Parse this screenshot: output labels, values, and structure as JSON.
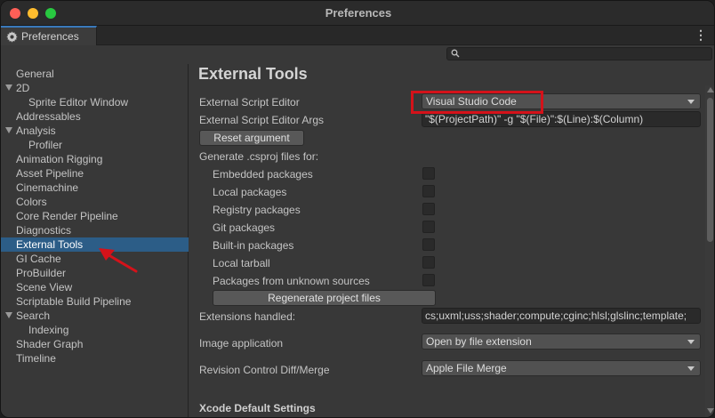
{
  "window": {
    "title": "Preferences"
  },
  "tab": {
    "label": "Preferences",
    "icon": "gear-icon"
  },
  "search": {
    "placeholder": "",
    "icon": "search-icon"
  },
  "sidebar": {
    "items": [
      {
        "label": "General",
        "indent": 0,
        "expander": false,
        "selected": false
      },
      {
        "label": "2D",
        "indent": 0,
        "expander": true,
        "selected": false
      },
      {
        "label": "Sprite Editor Window",
        "indent": 1,
        "expander": false,
        "selected": false
      },
      {
        "label": "Addressables",
        "indent": 0,
        "expander": false,
        "selected": false
      },
      {
        "label": "Analysis",
        "indent": 0,
        "expander": true,
        "selected": false
      },
      {
        "label": "Profiler",
        "indent": 1,
        "expander": false,
        "selected": false
      },
      {
        "label": "Animation Rigging",
        "indent": 0,
        "expander": false,
        "selected": false
      },
      {
        "label": "Asset Pipeline",
        "indent": 0,
        "expander": false,
        "selected": false
      },
      {
        "label": "Cinemachine",
        "indent": 0,
        "expander": false,
        "selected": false
      },
      {
        "label": "Colors",
        "indent": 0,
        "expander": false,
        "selected": false
      },
      {
        "label": "Core Render Pipeline",
        "indent": 0,
        "expander": false,
        "selected": false
      },
      {
        "label": "Diagnostics",
        "indent": 0,
        "expander": false,
        "selected": false
      },
      {
        "label": "External Tools",
        "indent": 0,
        "expander": false,
        "selected": true
      },
      {
        "label": "GI Cache",
        "indent": 0,
        "expander": false,
        "selected": false
      },
      {
        "label": "ProBuilder",
        "indent": 0,
        "expander": false,
        "selected": false
      },
      {
        "label": "Scene View",
        "indent": 0,
        "expander": false,
        "selected": false
      },
      {
        "label": "Scriptable Build Pipeline",
        "indent": 0,
        "expander": false,
        "selected": false
      },
      {
        "label": "Search",
        "indent": 0,
        "expander": true,
        "selected": false
      },
      {
        "label": "Indexing",
        "indent": 1,
        "expander": false,
        "selected": false
      },
      {
        "label": "Shader Graph",
        "indent": 0,
        "expander": false,
        "selected": false
      },
      {
        "label": "Timeline",
        "indent": 0,
        "expander": false,
        "selected": false
      }
    ]
  },
  "main": {
    "heading": "External Tools",
    "script_editor": {
      "label": "External Script Editor",
      "value": "Visual Studio Code"
    },
    "script_editor_args": {
      "label": "External Script Editor Args",
      "value": "\"$(ProjectPath)\" -g \"$(File)\":$(Line):$(Column)"
    },
    "reset_button": "Reset argument",
    "csproj_heading": "Generate .csproj files for:",
    "packages": [
      {
        "label": "Embedded packages",
        "checked": false
      },
      {
        "label": "Local packages",
        "checked": false
      },
      {
        "label": "Registry packages",
        "checked": false
      },
      {
        "label": "Git packages",
        "checked": false
      },
      {
        "label": "Built-in packages",
        "checked": false
      },
      {
        "label": "Local tarball",
        "checked": false
      },
      {
        "label": "Packages from unknown sources",
        "checked": false
      }
    ],
    "regenerate_button": "Regenerate project files",
    "extensions": {
      "label": "Extensions handled:",
      "value": "cs;uxml;uss;shader;compute;cginc;hlsl;glslinc;template;"
    },
    "image_app": {
      "label": "Image application",
      "value": "Open by file extension"
    },
    "revision": {
      "label": "Revision Control Diff/Merge",
      "value": "Apple File Merge"
    },
    "xcode_heading": "Xcode Default Settings"
  },
  "colors": {
    "selection": "#2c5d87",
    "highlight_box": "#d4121a",
    "annotation_arrow": "#d4121a",
    "tab_accent": "#3a79bb"
  }
}
